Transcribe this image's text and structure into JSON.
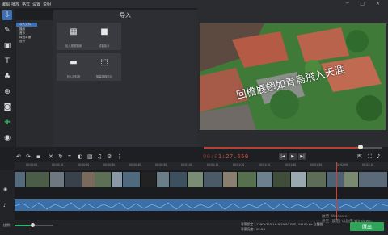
{
  "menu": {
    "items": [
      "编辑",
      "播放",
      "格式",
      "设置",
      "说明"
    ]
  },
  "import_panel": {
    "title": "导入",
    "categories": [
      "导入文件",
      "播放",
      "音乐",
      "绿色背景",
      "设计"
    ],
    "tiles": [
      {
        "icon": "add-files-icon",
        "label": "加入媒體檔案"
      },
      {
        "icon": "record-video-icon",
        "label": "錄製影片"
      },
      {
        "icon": "add-folder-icon",
        "label": "加入資料夾"
      },
      {
        "icon": "screen-capture-icon",
        "label": "螢幕擷取影片"
      }
    ]
  },
  "preview": {
    "caption": "回檐展翅如青鳥飛入天涯",
    "timecode_dim": "00:0",
    "timecode_main": "1:27.650",
    "playback_position": 0.88
  },
  "timeline": {
    "ruler_ticks": [
      "00:00:00",
      "00:00:10",
      "00:00:20",
      "00:00:30",
      "00:00:40",
      "00:00:50",
      "00:01:00",
      "00:01:10",
      "00:01:20",
      "00:01:30",
      "00:01:40",
      "00:01:50",
      "00:02:00",
      "00:02:10"
    ],
    "zoom_label": "比例："
  },
  "status": {
    "settings_line1": "專案設定：1280x720 16:9 29.97 FPS, 44100 Hz 立體聲",
    "settings_line2": "專案長度：02:28",
    "activate_line1": "啟用 Windows",
    "activate_line2": "移至 [設定] 以啟用 Windows。",
    "export_label": "匯出"
  },
  "colors": {
    "accent": "#2fa55a",
    "timecode": "#d04f3c",
    "playhead": "#d0402f",
    "audio": "#3a6fa8"
  }
}
